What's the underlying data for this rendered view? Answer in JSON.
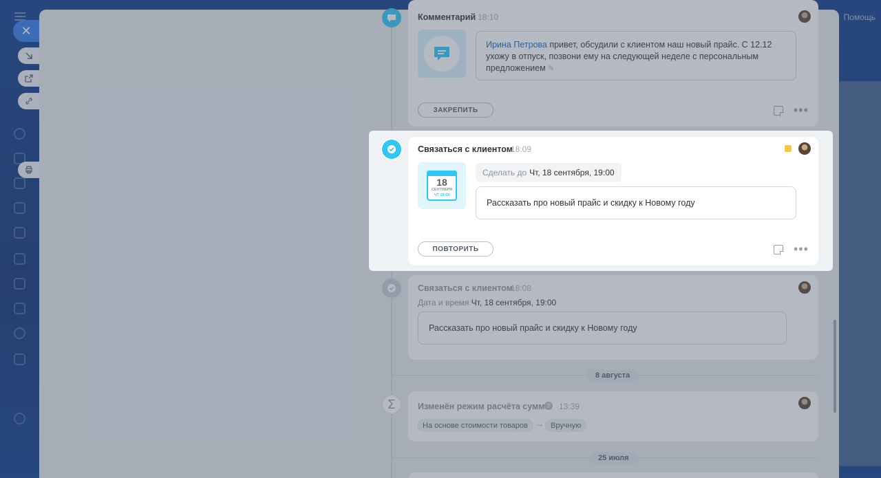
{
  "app": {
    "help_label": "Помощь"
  },
  "timeline": {
    "comment": {
      "title": "Комментарий",
      "time": "18:10",
      "mention": "Ирина Петрова",
      "text": " привет, обсудили с клиентом наш новый прайс. С 12.12 ухожу в отпуск, позвони ему на следующей неделе с персональным предложением",
      "pin_button": "ЗАКРЕПИТЬ"
    },
    "task_active": {
      "title": "Связаться с клиентом",
      "time": "18:09",
      "deadline_label": "Сделать до",
      "deadline_value": "Чт, 18 сентября, 19:00",
      "calendar_day": "18",
      "calendar_month": "СЕНТЯБРЯ",
      "calendar_time": "ЧТ 19:00",
      "description": "Рассказать про новый прайс и скидку к Новому году",
      "repeat_button": "ПОВТОРИТЬ",
      "status_color": "#f7c742"
    },
    "task_done": {
      "title": "Связаться с клиентом",
      "time": "18:08",
      "datetime_label": "Дата и время",
      "datetime_value": "Чт, 18 сентября, 19:00",
      "description": "Рассказать про новый прайс и скидку к Новому году"
    },
    "date_sep_1": "8 августа",
    "sum_mode": {
      "title": "Изменён режим расчёта суммы",
      "time": "13:39",
      "from": "На основе стоимости товаров",
      "arrow": "→",
      "to": "Вручную"
    },
    "date_sep_2": "25 июля"
  },
  "colors": {
    "accent": "#2fc6f6",
    "primary": "#2f7be8"
  }
}
